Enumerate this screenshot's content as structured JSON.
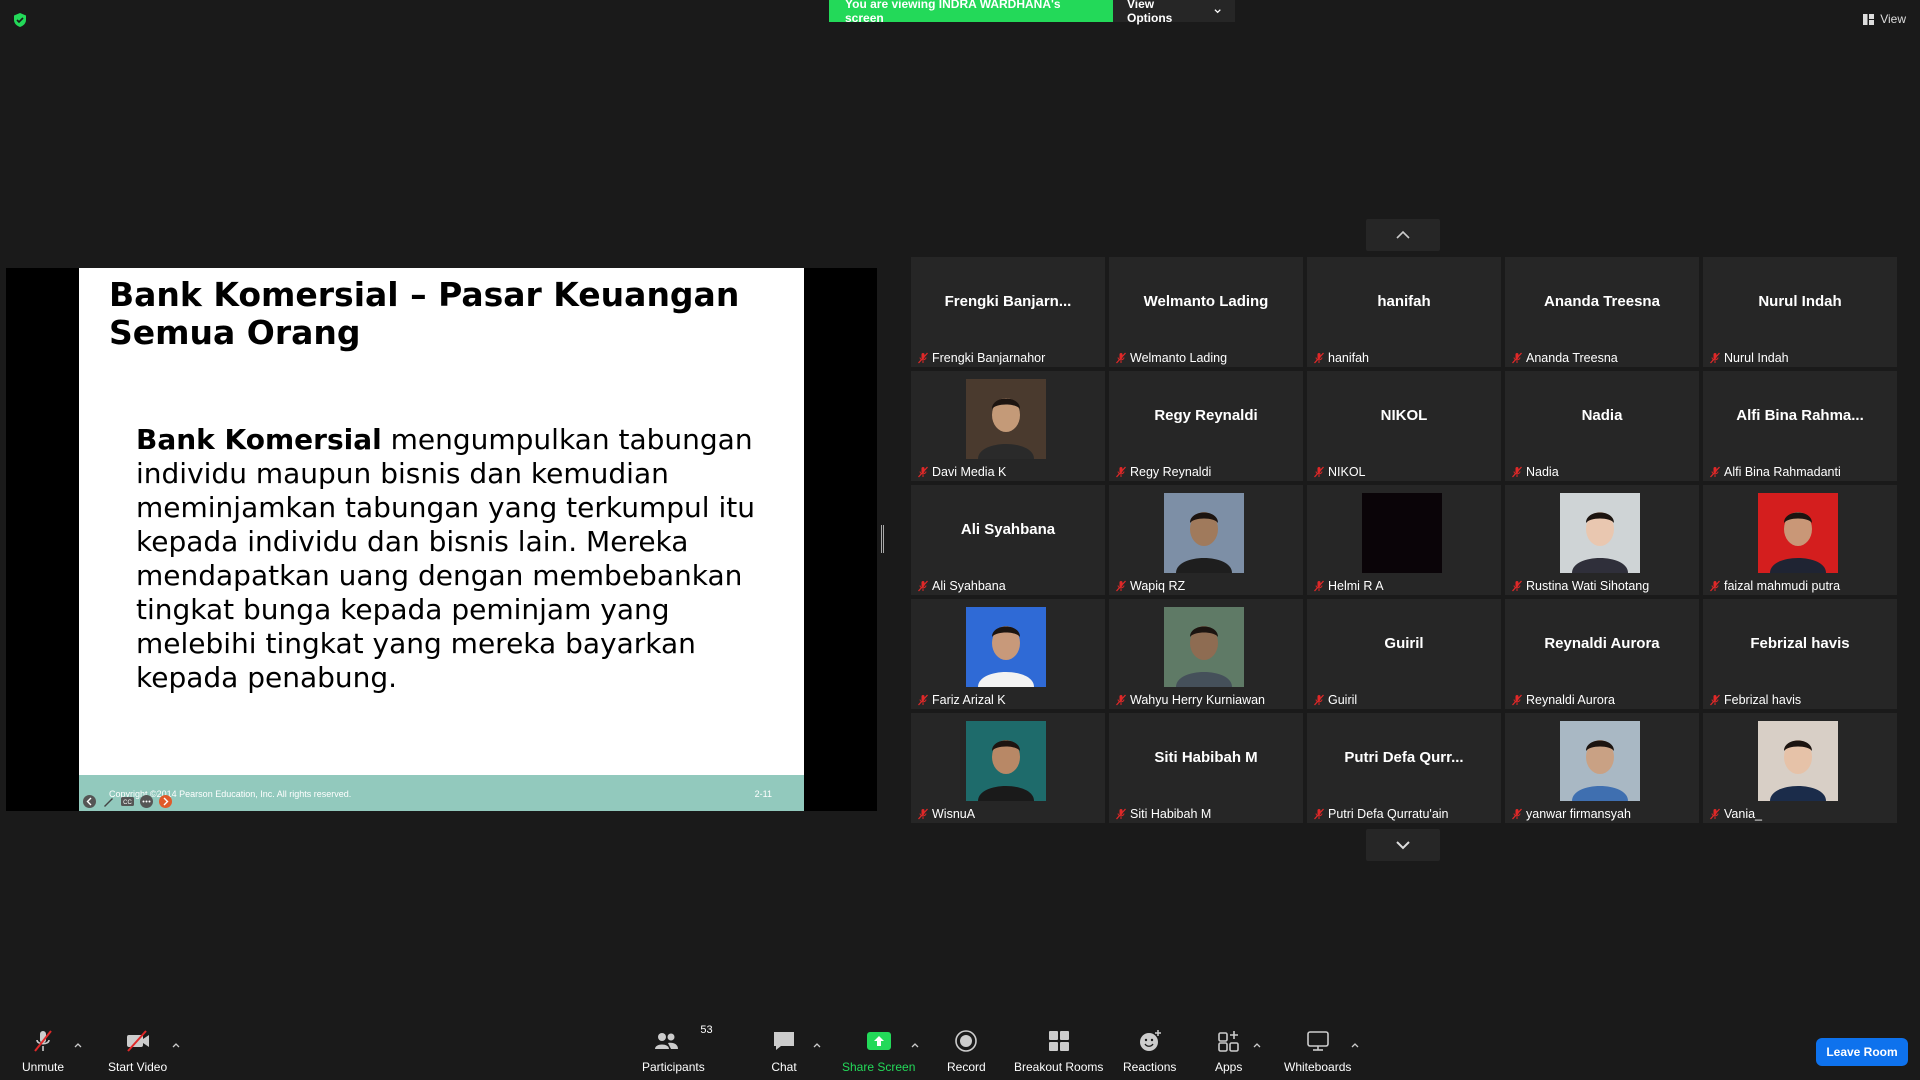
{
  "banner": {
    "viewing_text": "You are viewing INDRA WARDHANA's screen",
    "view_options_label": "View Options",
    "view_label": "View",
    "accent": "#23d959"
  },
  "slide": {
    "title": "Bank Komersial – Pasar Keuangan Semua Orang",
    "body_bold": "Bank Komersial",
    "body_rest": " mengumpulkan tabungan individu maupun bisnis dan kemudian meminjamkan tabungan yang terkumpul itu kepada individu dan bisnis lain. Mereka mendapatkan uang dengan membebankan tingkat bunga kepada peminjam yang melebihi tingkat yang mereka bayarkan kepada penabung.",
    "footer_copyright": "Copyright ©2014 Pearson Education, Inc. All rights reserved.",
    "footer_page": "2-11",
    "footer_color": "#92c9bd"
  },
  "gallery": [
    {
      "big": "Frengki  Banjarn...",
      "name": "Frengki Banjarnahor"
    },
    {
      "big": "Welmanto Lading",
      "name": "Welmanto Lading"
    },
    {
      "big": "hanifah",
      "name": "hanifah"
    },
    {
      "big": "Ananda Treesna",
      "name": "Ananda Treesna"
    },
    {
      "big": "Nurul Indah",
      "name": "Nurul Indah"
    },
    {
      "photo": "photo-davi",
      "name": "Davi Media K"
    },
    {
      "big": "Regy Reynaldi",
      "name": "Regy Reynaldi"
    },
    {
      "big": "NIKOL",
      "name": "NIKOL"
    },
    {
      "big": "Nadia",
      "name": "Nadia"
    },
    {
      "big": "Alfi Bina Rahma...",
      "name": "Alfi Bina Rahmadanti"
    },
    {
      "big": "Ali Syahbana",
      "name": "Ali Syahbana"
    },
    {
      "photo": "photo-wapiq",
      "name": "Wapiq RZ"
    },
    {
      "photo": "photo-helmi",
      "name": "Helmi R A"
    },
    {
      "photo": "photo-rustina",
      "name": "Rustina Wati Sihotang"
    },
    {
      "photo": "photo-faizal",
      "name": "faizal mahmudi putra"
    },
    {
      "photo": "photo-fariz",
      "name": "Fariz Arizal K"
    },
    {
      "photo": "photo-wahyu",
      "name": "Wahyu Herry Kurniawan"
    },
    {
      "big": "Guiril",
      "name": "Guiril"
    },
    {
      "big": "Reynaldi Aurora",
      "name": "Reynaldi Aurora"
    },
    {
      "big": "Febrizal havis",
      "name": "Febrizal havis"
    },
    {
      "photo": "photo-wisnu",
      "name": "WisnuA"
    },
    {
      "big": "Siti Habibah M",
      "name": "Siti Habibah M"
    },
    {
      "big": "Putri  Defa  Qurr...",
      "name": "Putri Defa Qurratu'ain"
    },
    {
      "photo": "photo-yanwar",
      "name": "yanwar firmansyah"
    },
    {
      "photo": "photo-vania",
      "name": "Vania_"
    }
  ],
  "toolbar": {
    "unmute": "Unmute",
    "start_video": "Start Video",
    "participants": "Participants",
    "participants_count": "53",
    "chat": "Chat",
    "share_screen": "Share Screen",
    "record": "Record",
    "breakout_rooms": "Breakout Rooms",
    "reactions": "Reactions",
    "apps": "Apps",
    "whiteboards": "Whiteboards",
    "leave_room": "Leave Room",
    "leave_color": "#0e72ed"
  }
}
